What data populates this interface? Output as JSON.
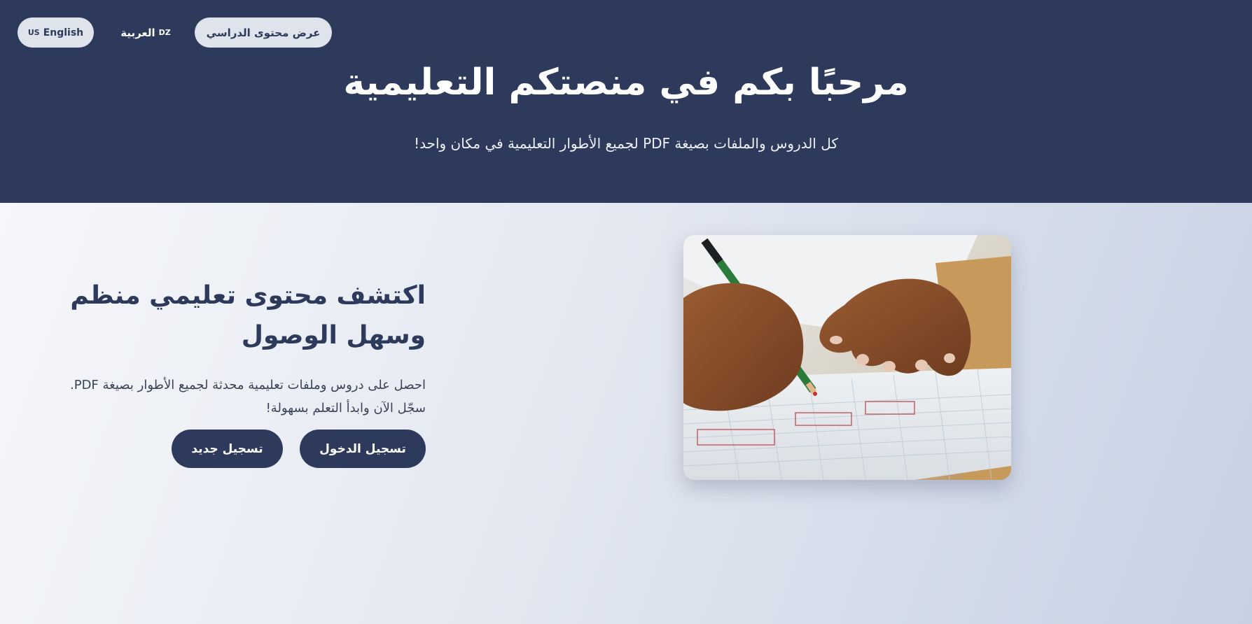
{
  "header": {
    "nav": {
      "english": {
        "flag": "US",
        "label": "English"
      },
      "arabic": {
        "flag": "DZ",
        "label": "العربية"
      },
      "view_content_label": "عرض محتوى الدراسي"
    },
    "title": "مرحبًا بكم في منصتكم التعليمية",
    "subtitle": "كل الدروس والملفات بصيغة PDF لجميع الأطوار التعليمية في مكان واحد!"
  },
  "main": {
    "title_line1": "اكتشف محتوى تعليمي منظم",
    "title_line2": "وسهل الوصول",
    "description_line1": "احصل على دروس وملفات تعليمية محدثة لجميع الأطوار بصيغة PDF.",
    "description_line2": "سجّل الآن وابدأ التعلم بسهولة!",
    "login_label": "تسجيل الدخول",
    "register_label": "تسجيل جديد"
  },
  "image": {
    "icon": "student-writing-photo"
  },
  "colors": {
    "header_bg": "#2d3a5c",
    "accent": "#2d3a5c",
    "pill_bg": "#dfe3ec"
  }
}
